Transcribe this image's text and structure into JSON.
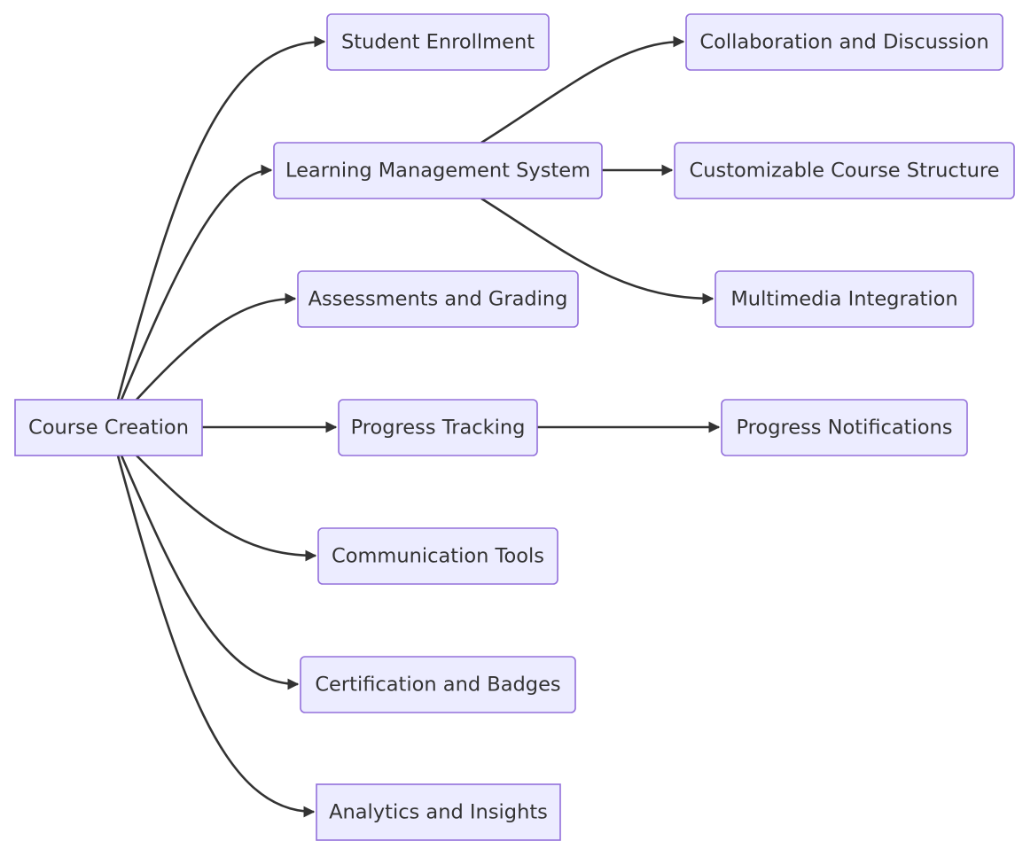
{
  "diagram": {
    "type": "flowchart",
    "direction": "left-to-right",
    "style": {
      "node_fill": "#ECECFF",
      "node_border": "#9370DB",
      "edge_color": "#333333",
      "text_color": "#333333",
      "background": "#FFFFFF"
    },
    "nodes": [
      {
        "id": "course_creation",
        "label": "Course Creation",
        "shape": "rect"
      },
      {
        "id": "student_enrollment",
        "label": "Student Enrollment",
        "shape": "round"
      },
      {
        "id": "lms",
        "label": "Learning Management System",
        "shape": "round"
      },
      {
        "id": "assessments",
        "label": "Assessments and Grading",
        "shape": "round"
      },
      {
        "id": "progress_tracking",
        "label": "Progress Tracking",
        "shape": "round"
      },
      {
        "id": "communication",
        "label": "Communication Tools",
        "shape": "round"
      },
      {
        "id": "certification",
        "label": "Certification and Badges",
        "shape": "round"
      },
      {
        "id": "analytics",
        "label": "Analytics and Insights",
        "shape": "rect"
      },
      {
        "id": "collaboration",
        "label": "Collaboration and Discussion",
        "shape": "round"
      },
      {
        "id": "customizable",
        "label": "Customizable Course Structure",
        "shape": "round"
      },
      {
        "id": "multimedia",
        "label": "Multimedia Integration",
        "shape": "round"
      },
      {
        "id": "progress_notifications",
        "label": "Progress Notifications",
        "shape": "round"
      }
    ],
    "edges": [
      {
        "from": "course_creation",
        "to": "student_enrollment"
      },
      {
        "from": "course_creation",
        "to": "lms"
      },
      {
        "from": "course_creation",
        "to": "assessments"
      },
      {
        "from": "course_creation",
        "to": "progress_tracking"
      },
      {
        "from": "course_creation",
        "to": "communication"
      },
      {
        "from": "course_creation",
        "to": "certification"
      },
      {
        "from": "course_creation",
        "to": "analytics"
      },
      {
        "from": "lms",
        "to": "collaboration"
      },
      {
        "from": "lms",
        "to": "customizable"
      },
      {
        "from": "lms",
        "to": "multimedia"
      },
      {
        "from": "progress_tracking",
        "to": "progress_notifications"
      }
    ]
  }
}
